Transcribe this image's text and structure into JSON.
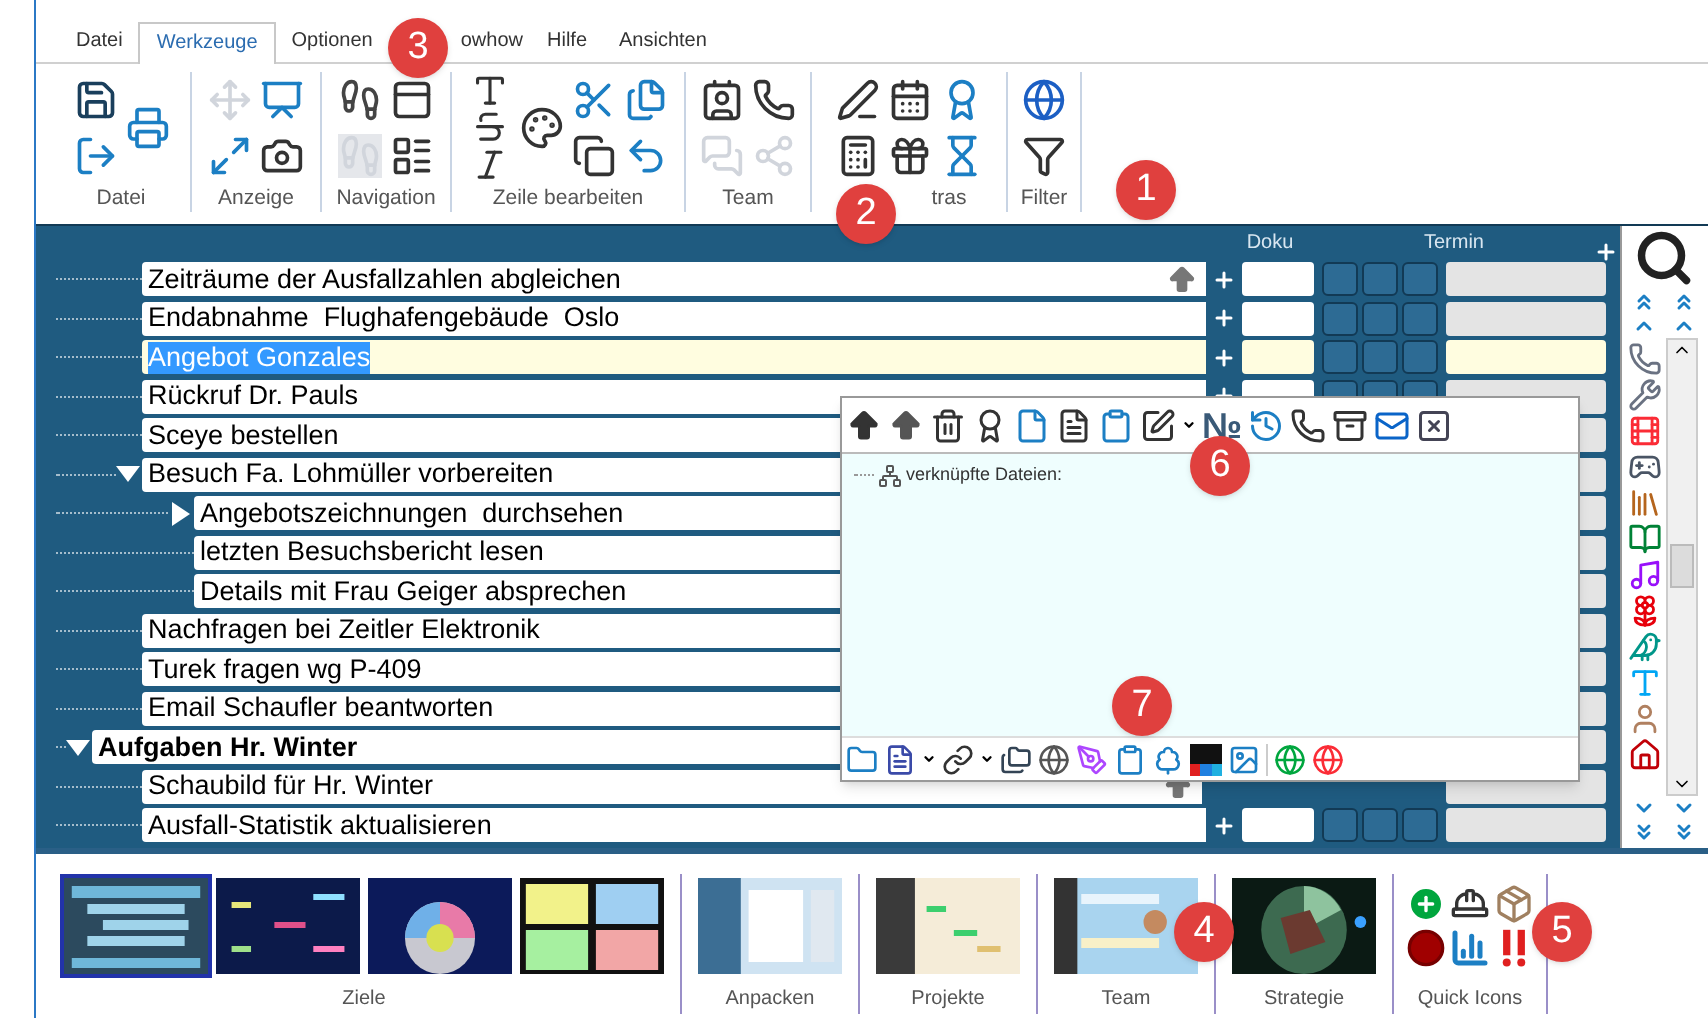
{
  "tabs": [
    {
      "label": "Datei",
      "selected": false
    },
    {
      "label": "Werkzeuge",
      "selected": true
    },
    {
      "label": "Optionen",
      "selected": false
    },
    {
      "label": "owhow",
      "selected": false
    },
    {
      "label": "Hilfe",
      "selected": false
    },
    {
      "label": "Ansichten",
      "selected": false
    }
  ],
  "ribbon": {
    "groups": [
      {
        "label": "Datei"
      },
      {
        "label": "Anzeige"
      },
      {
        "label": "Navigation"
      },
      {
        "label": "Zeile bearbeiten"
      },
      {
        "label": "Team"
      },
      {
        "label": "tras"
      },
      {
        "label": "Filter"
      }
    ]
  },
  "columns": [
    {
      "label": "Doku"
    },
    {
      "label": "Termin"
    }
  ],
  "tree": [
    {
      "children": [
        {
          "label": "Zeiträume der Ausfallzahlen abgleichen",
          "selected": false,
          "marked": true
        },
        {
          "label": "Endabnahme  Flughafengebäude  Oslo",
          "selected": false,
          "marked": false
        },
        {
          "label": "Angebot Gonzales",
          "selected": true,
          "marked": false
        },
        {
          "label": "Rückruf Dr. Pauls",
          "selected": false
        },
        {
          "label": "Sceye bestellen",
          "selected": false
        },
        {
          "label": "Besuch Fa. Lohmüller vorbereiten",
          "selected": false,
          "expanded": true,
          "children": [
            {
              "label": "Angebotszeichnungen  durchsehen",
              "selected": false,
              "expanded": false
            },
            {
              "label": "letzten Besuchsbericht lesen",
              "selected": false
            },
            {
              "label": "Details mit Frau Geiger absprechen",
              "selected": false
            }
          ]
        },
        {
          "label": "Nachfragen bei Zeitler Elektronik",
          "selected": false
        },
        {
          "label": "Turek fragen wg P-409",
          "selected": false
        },
        {
          "label": "Email Schaufler beantworten",
          "selected": false
        }
      ]
    },
    {
      "label": "Aufgaben Hr. Winter",
      "selected": false,
      "expanded": true,
      "children": [
        {
          "label": "Schaubild für Hr. Winter",
          "selected": false,
          "marked": true
        },
        {
          "label": "Ausfall-Statistik aktualisieren",
          "selected": false,
          "marked": false
        }
      ]
    }
  ],
  "panel": {
    "glyph": "№",
    "label": "verknüpfte Dateien:"
  },
  "gallery": [
    {
      "label": "Ziele",
      "kind": "thumbnails",
      "items": [
        {
          "kind": "picture",
          "selected": true
        },
        {
          "kind": "picture",
          "selected": false
        },
        {
          "kind": "picture",
          "selected": false
        },
        {
          "kind": "picture",
          "selected": false
        }
      ]
    },
    {
      "label": "Anpacken",
      "kind": "thumbnails",
      "items": [
        {
          "kind": "picture",
          "selected": false
        }
      ]
    },
    {
      "label": "Projekte",
      "kind": "thumbnails",
      "items": [
        {
          "kind": "picture",
          "selected": false
        }
      ]
    },
    {
      "label": "Team",
      "kind": "thumbnails",
      "items": [
        {
          "kind": "picture",
          "selected": false
        }
      ]
    },
    {
      "label": "Strategie",
      "kind": "thumbnails",
      "items": [
        {
          "kind": "picture",
          "selected": false
        }
      ]
    },
    {
      "label": "Quick Icons",
      "kind": "icons"
    }
  ],
  "callouts": [
    {
      "label": "3"
    },
    {
      "label": "1"
    },
    {
      "label": "2"
    },
    {
      "label": "6"
    },
    {
      "label": "7"
    },
    {
      "label": "4"
    },
    {
      "label": "5"
    }
  ]
}
